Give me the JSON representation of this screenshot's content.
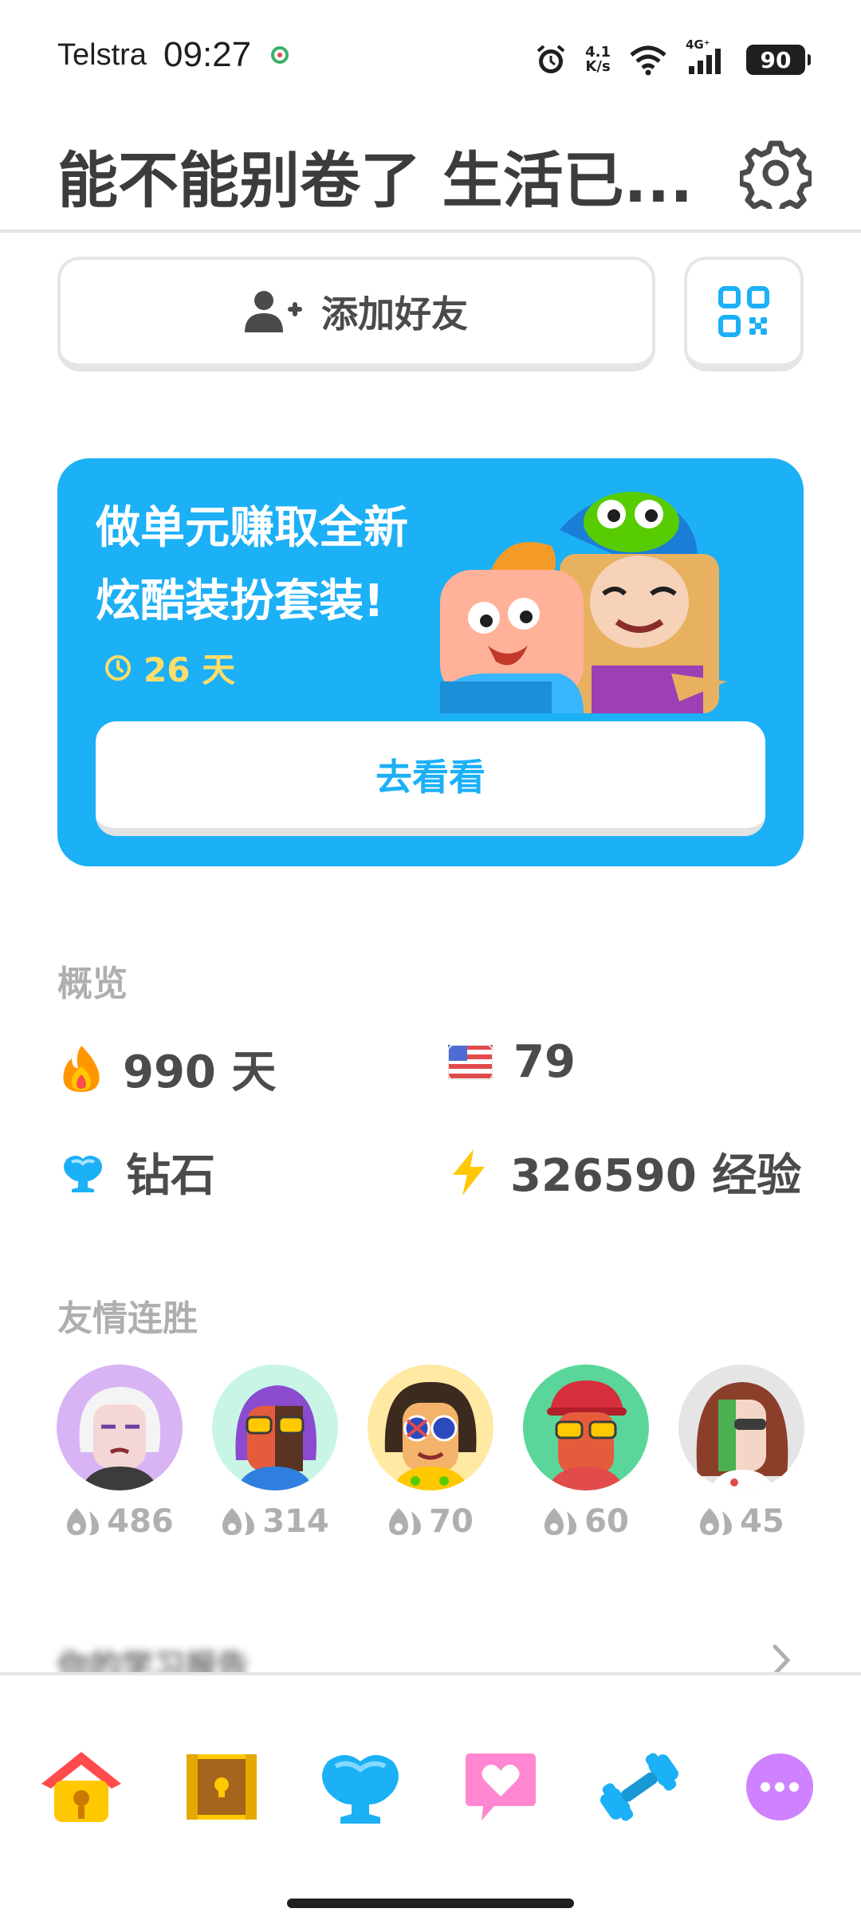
{
  "status_bar": {
    "carrier": "Telstra",
    "time": "09:27",
    "net_speed_value": "4.1",
    "net_speed_unit": "K/s",
    "signal_label": "4G⁺",
    "battery": "90"
  },
  "header": {
    "title": "能不能别卷了 生活已..."
  },
  "add_friend": {
    "label": "添加好友"
  },
  "promo": {
    "line1": "做单元赚取全新",
    "line2": "炫酷装扮套装!",
    "days_left": "26 天",
    "button_label": "去看看",
    "color": "#1cb0f6"
  },
  "overview": {
    "title": "概览",
    "streak": "990 天",
    "course_value": "79",
    "league": "钻石",
    "xp": "326590 经验"
  },
  "friend_streaks": {
    "title": "友情连胜",
    "friends": [
      {
        "count": "486"
      },
      {
        "count": "314"
      },
      {
        "count": "70"
      },
      {
        "count": "60"
      },
      {
        "count": "45"
      }
    ]
  },
  "blurred_row": {
    "text": "你的学习报告"
  },
  "bottom_nav": {
    "items": [
      "home-icon",
      "treasure-chest-icon",
      "league-icon",
      "heart-icon",
      "dumbbell-icon",
      "more-icon"
    ]
  }
}
